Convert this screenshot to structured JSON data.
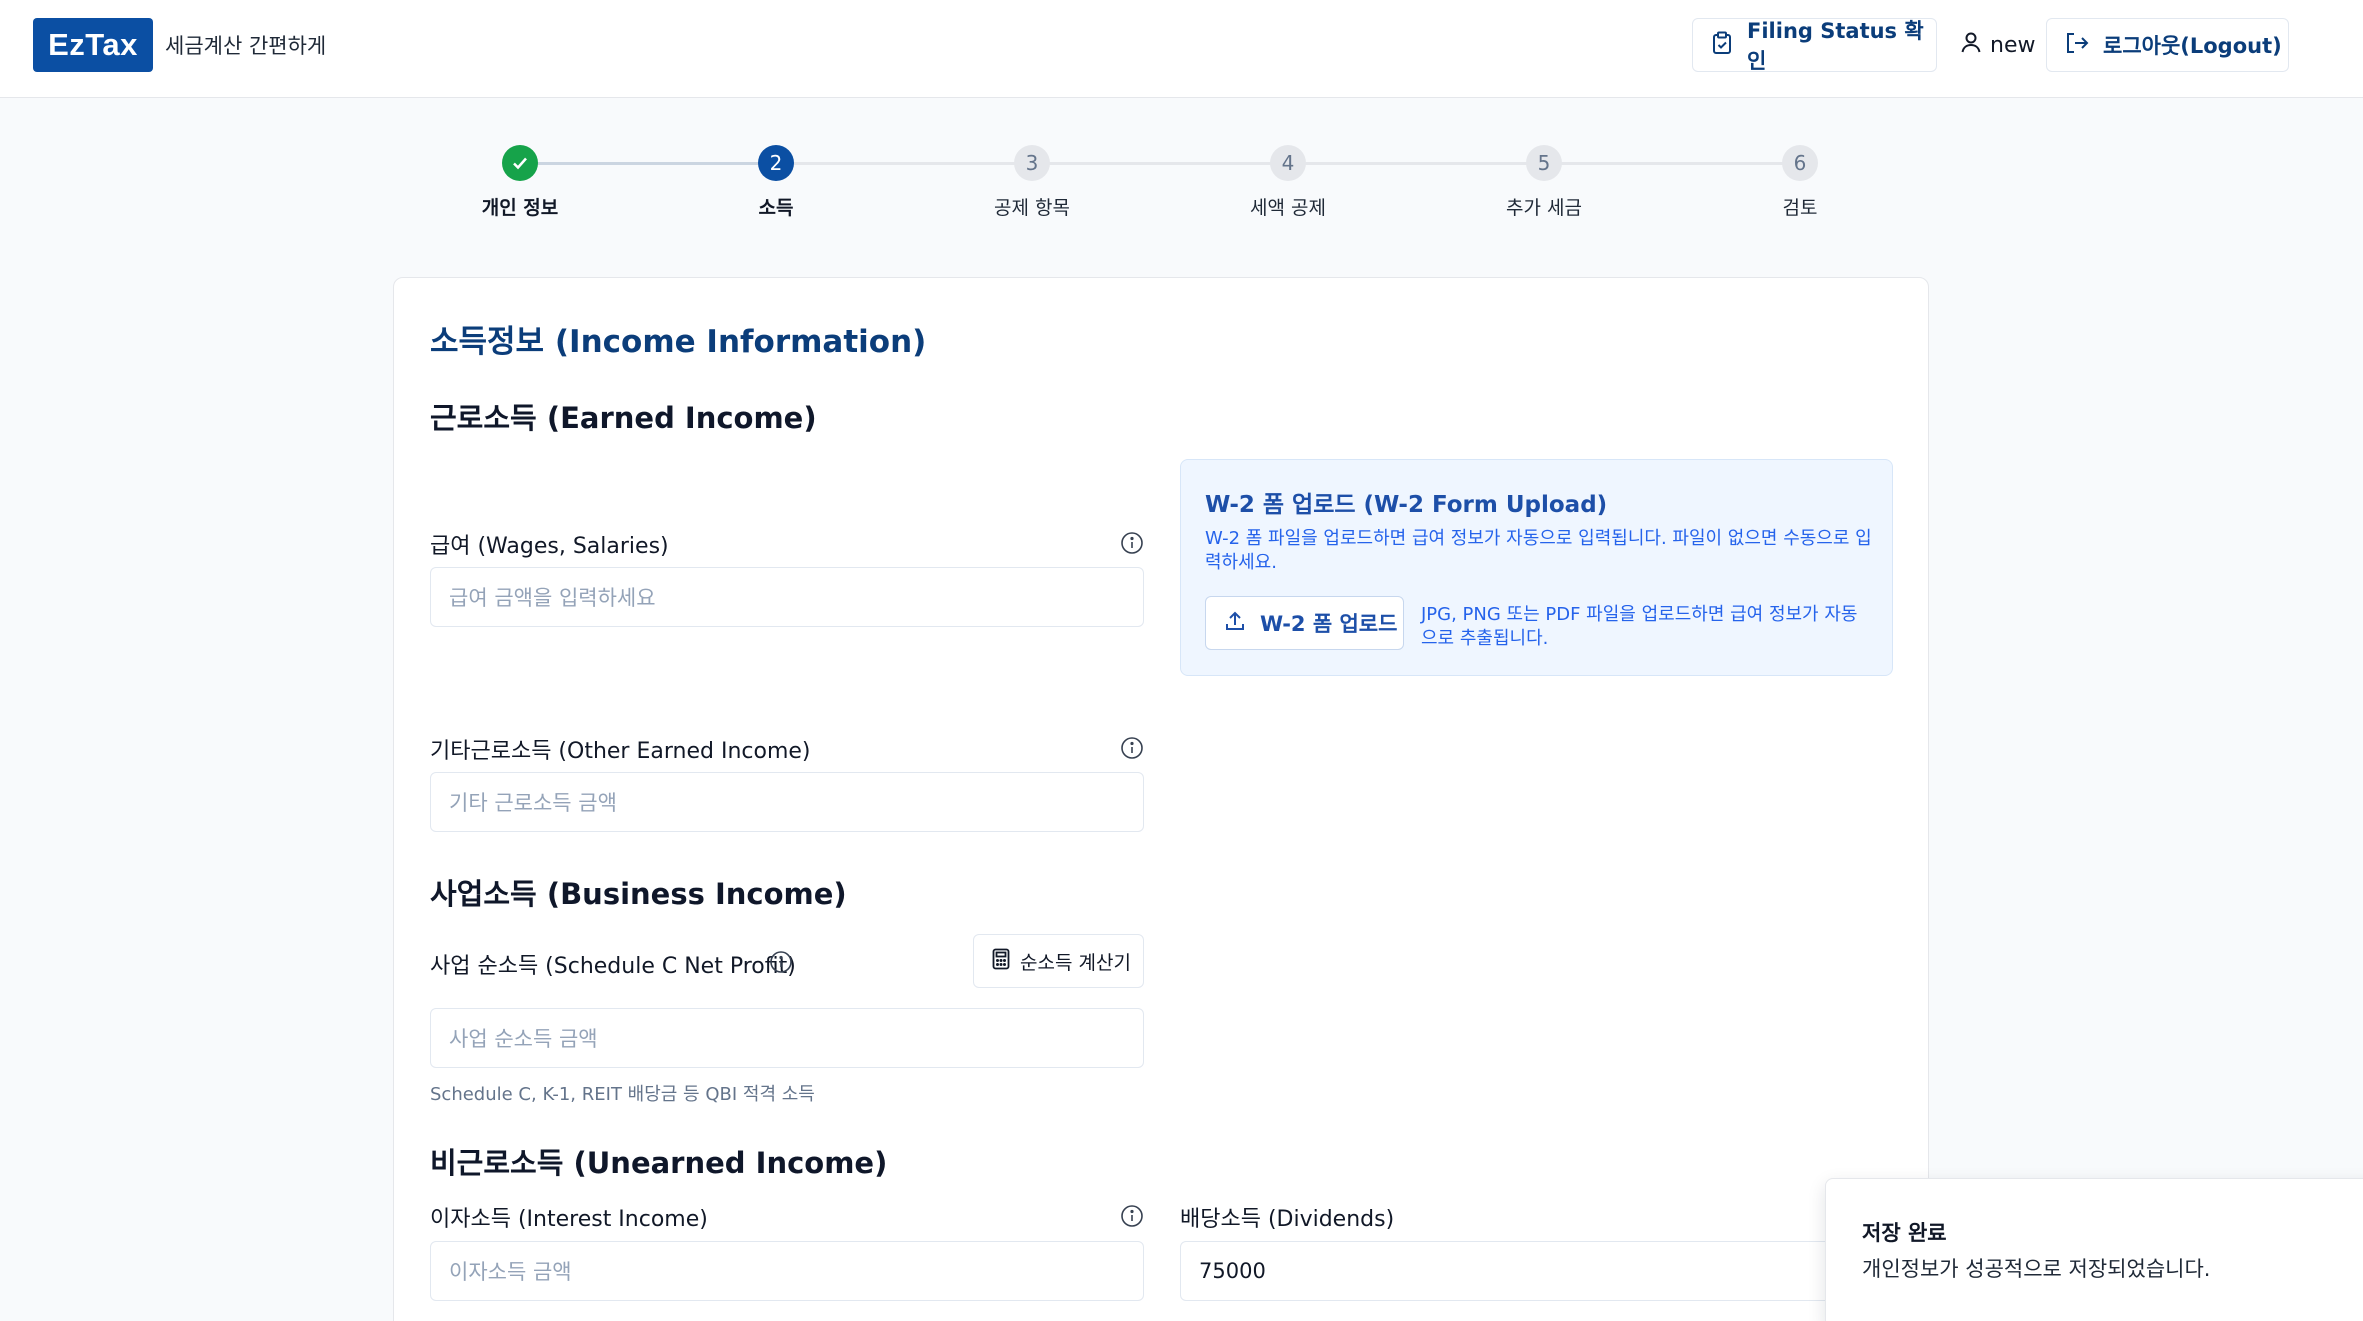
{
  "header": {
    "logo": "EzTax",
    "tagline": "세금계산 간편하게",
    "filing_status_label": "Filing Status 확인",
    "username": "new",
    "logout_label": "로그아웃(Logout)"
  },
  "stepper": {
    "steps": [
      {
        "number": "1",
        "label": "개인 정보",
        "state": "done"
      },
      {
        "number": "2",
        "label": "소득",
        "state": "active"
      },
      {
        "number": "3",
        "label": "공제 항목",
        "state": "pending"
      },
      {
        "number": "4",
        "label": "세액 공제",
        "state": "pending"
      },
      {
        "number": "5",
        "label": "추가 세금",
        "state": "pending"
      },
      {
        "number": "6",
        "label": "검토",
        "state": "pending"
      }
    ]
  },
  "form": {
    "title": "소득정보 (Income Information)",
    "earned": {
      "heading": "근로소득 (Earned Income)",
      "wages_label": "급여 (Wages, Salaries)",
      "wages_placeholder": "급여 금액을 입력하세요",
      "other_label": "기타근로소득 (Other Earned Income)",
      "other_placeholder": "기타 근로소득 금액"
    },
    "w2": {
      "title": "W-2 폼 업로드 (W-2 Form Upload)",
      "description": "W-2 폼 파일을 업로드하면 급여 정보가 자동으로 입력됩니다. 파일이 없으면 수동으로 입력하세요.",
      "button_label": "W-2 폼 업로드",
      "note": "JPG, PNG 또는 PDF 파일을 업로드하면 급여 정보가 자동으로 추출됩니다."
    },
    "business": {
      "heading": "사업소득 (Business Income)",
      "net_label": "사업 순소득 (Schedule C Net Profit)",
      "calculator_label": "순소득 계산기",
      "net_placeholder": "사업 순소득 금액",
      "hint": "Schedule C, K-1, REIT 배당금 등 QBI 적격 소득"
    },
    "unearned": {
      "heading": "비근로소득 (Unearned Income)",
      "interest_label": "이자소득 (Interest Income)",
      "interest_placeholder": "이자소득 금액",
      "dividends_label": "배당소득 (Dividends)",
      "dividends_value": "75000"
    }
  },
  "toast": {
    "title": "저장 완료",
    "message": "개인정보가 성공적으로 저장되었습니다."
  },
  "colors": {
    "brand": "#0b4fa3",
    "success": "#16a34a",
    "accent_text": "#0b3d7a"
  }
}
